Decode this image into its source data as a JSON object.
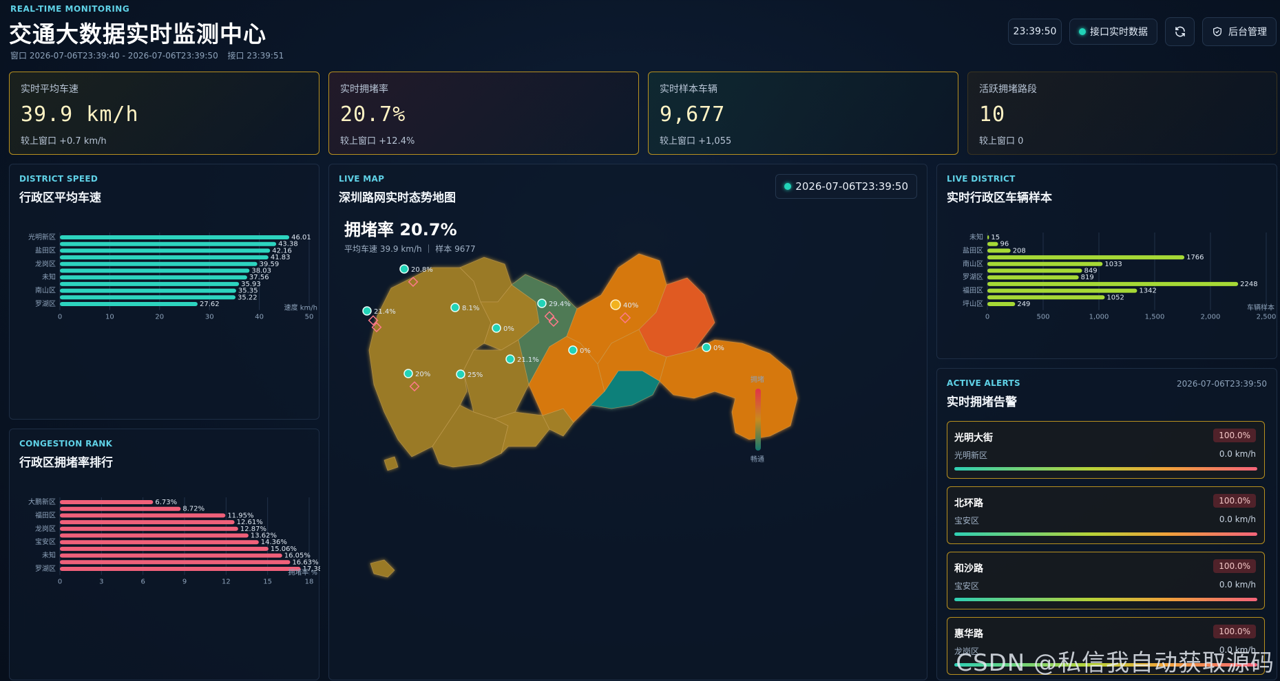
{
  "header": {
    "eyebrow": "REAL-TIME MONITORING",
    "title": "交通大数据实时监测中心",
    "window_range": "窗口 2026-07-06T23:39:40 - 2026-07-06T23:39:50",
    "interface_time": "接口 23:39:51",
    "clock": "23:39:50",
    "realtime_label": "接口实时数据",
    "refresh_icon": "refresh-icon",
    "admin_icon": "shield-icon",
    "admin_label": "后台管理"
  },
  "kpis": [
    {
      "label": "实时平均车速",
      "value": "39.9 km/h",
      "compare": "较上窗口 +0.7 km/h"
    },
    {
      "label": "实时拥堵率",
      "value": "20.7%",
      "compare": "较上窗口 +12.4%"
    },
    {
      "label": "实时样本车辆",
      "value": "9,677",
      "compare": "较上窗口 +1,055"
    },
    {
      "label": "活跃拥堵路段",
      "value": "10",
      "compare": "较上窗口 0"
    }
  ],
  "district_speed": {
    "tag": "DISTRICT SPEED",
    "title": "行政区平均车速"
  },
  "congestion_rank": {
    "tag": "CONGESTION RANK",
    "title": "行政区拥堵率排行"
  },
  "live_map": {
    "tag": "LIVE MAP",
    "title": "深圳路网实时态势地图",
    "timestamp": "2026-07-06T23:39:50",
    "headline": "拥堵率 20.7%",
    "subline": "平均车速 39.9 km/h ｜ 样本 9677",
    "legend_top": "拥堵",
    "legend_bottom": "畅通",
    "markers": [
      "20.8%",
      "21.4%",
      "8.1%",
      "0%",
      "29.4%",
      "40%",
      "0%",
      "0%",
      "21.1%",
      "20%",
      "25%"
    ],
    "colors": {
      "orange": "#d6780f",
      "olive": "#9a7a26",
      "green": "#4f7a55",
      "teal": "#10807a",
      "red": "#e05a24"
    }
  },
  "live_district": {
    "tag": "LIVE DISTRICT",
    "title": "实时行政区车辆样本"
  },
  "alerts": {
    "tag": "ACTIVE ALERTS",
    "title": "实时拥堵告警",
    "timestamp": "2026-07-06T23:39:50",
    "items": [
      {
        "road": "光明大街",
        "district": "光明新区",
        "pct": "100.0%",
        "speed": "0.0 km/h"
      },
      {
        "road": "北环路",
        "district": "宝安区",
        "pct": "100.0%",
        "speed": "0.0 km/h"
      },
      {
        "road": "和沙路",
        "district": "宝安区",
        "pct": "100.0%",
        "speed": "0.0 km/h"
      },
      {
        "road": "惠华路",
        "district": "龙岗区",
        "pct": "100.0%",
        "speed": "0.0 km/h"
      }
    ]
  },
  "watermark": "CSDN @私信我自动获取源码",
  "chart_data": [
    {
      "type": "bar",
      "orientation": "horizontal",
      "categories": [
        "光明新区",
        "",
        "盐田区",
        "",
        "龙岗区",
        "",
        "未知",
        "",
        "南山区",
        "",
        "罗湖区"
      ],
      "values": [
        46.01,
        43.38,
        42.16,
        41.83,
        39.59,
        38.03,
        37.56,
        35.93,
        35.35,
        35.22,
        27.62
      ],
      "xlabel": "速度 km/h",
      "xlim": [
        0,
        50
      ],
      "xticks": [
        0,
        10,
        20,
        30,
        40,
        50
      ],
      "color": "#2dd4bf"
    },
    {
      "type": "bar",
      "orientation": "horizontal",
      "categories": [
        "大鹏新区",
        "",
        "福田区",
        "",
        "龙岗区",
        "",
        "宝安区",
        "",
        "未知",
        "",
        "罗湖区"
      ],
      "values": [
        6.73,
        8.72,
        11.95,
        12.61,
        12.87,
        13.62,
        14.36,
        15.06,
        16.05,
        16.63,
        17.38
      ],
      "value_suffix": "%",
      "xlabel": "拥堵率 %",
      "xlim": [
        0,
        18
      ],
      "xticks": [
        0,
        3,
        6,
        9,
        12,
        15,
        18
      ],
      "color": "#f0607a"
    },
    {
      "type": "bar",
      "orientation": "horizontal",
      "categories": [
        "未知",
        "",
        "盐田区",
        "",
        "南山区",
        "",
        "罗湖区",
        "",
        "福田区",
        "",
        "坪山区"
      ],
      "values": [
        15,
        96,
        208,
        1766,
        1033,
        849,
        819,
        2248,
        1342,
        1052,
        249
      ],
      "xlabel": "车辆样本",
      "xlim": [
        0,
        2500
      ],
      "xticks": [
        "0",
        "500",
        "1,000",
        "1,500",
        "2,000",
        "2,500"
      ],
      "color": "#a6d936"
    }
  ]
}
